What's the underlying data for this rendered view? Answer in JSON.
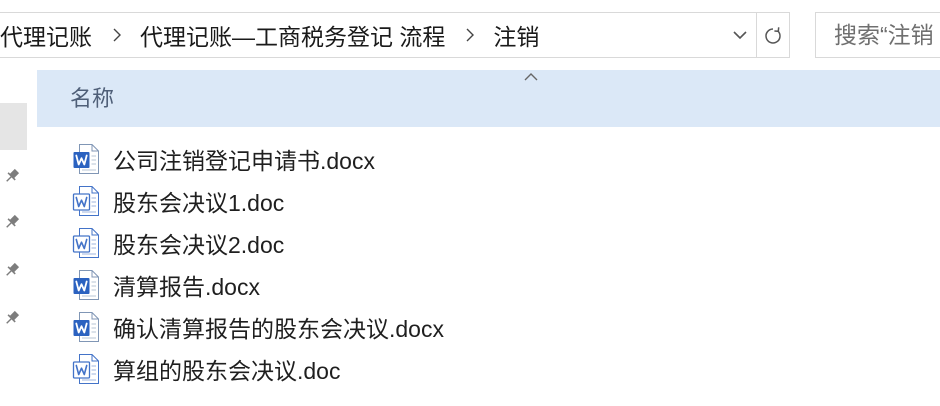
{
  "address_bar": {
    "breadcrumbs": [
      "代理记账",
      "代理记账—工商税务登记 流程",
      "注销"
    ]
  },
  "search": {
    "placeholder": "搜索“注销"
  },
  "file_list": {
    "columns": [
      {
        "label": "名称"
      }
    ],
    "files": [
      {
        "name": "公司注销登记申请书.docx",
        "icon": "word-docx-icon"
      },
      {
        "name": "股东会决议1.doc",
        "icon": "word-doc-icon"
      },
      {
        "name": "股东会决议2.doc",
        "icon": "word-doc-icon"
      },
      {
        "name": "清算报告.docx",
        "icon": "word-docx-icon"
      },
      {
        "name": "确认清算报告的股东会决议.docx",
        "icon": "word-docx-icon"
      },
      {
        "name": "算组的股东会决议.doc",
        "icon": "word-doc-icon"
      }
    ]
  },
  "icons": {
    "breadcrumb_separator": "chevron-right-icon",
    "history_dropdown": "chevron-down-icon",
    "refresh": "refresh-icon",
    "sort_indicator": "sort-ascending-icon",
    "pinned": "pin-icon"
  },
  "colors": {
    "header-hover-bg": "#dbe8f7",
    "nav-selected-bg": "#e5e5e5",
    "word-blue": "#2b62c0",
    "border": "#d9d9d9",
    "text": "#1f1f1f"
  }
}
